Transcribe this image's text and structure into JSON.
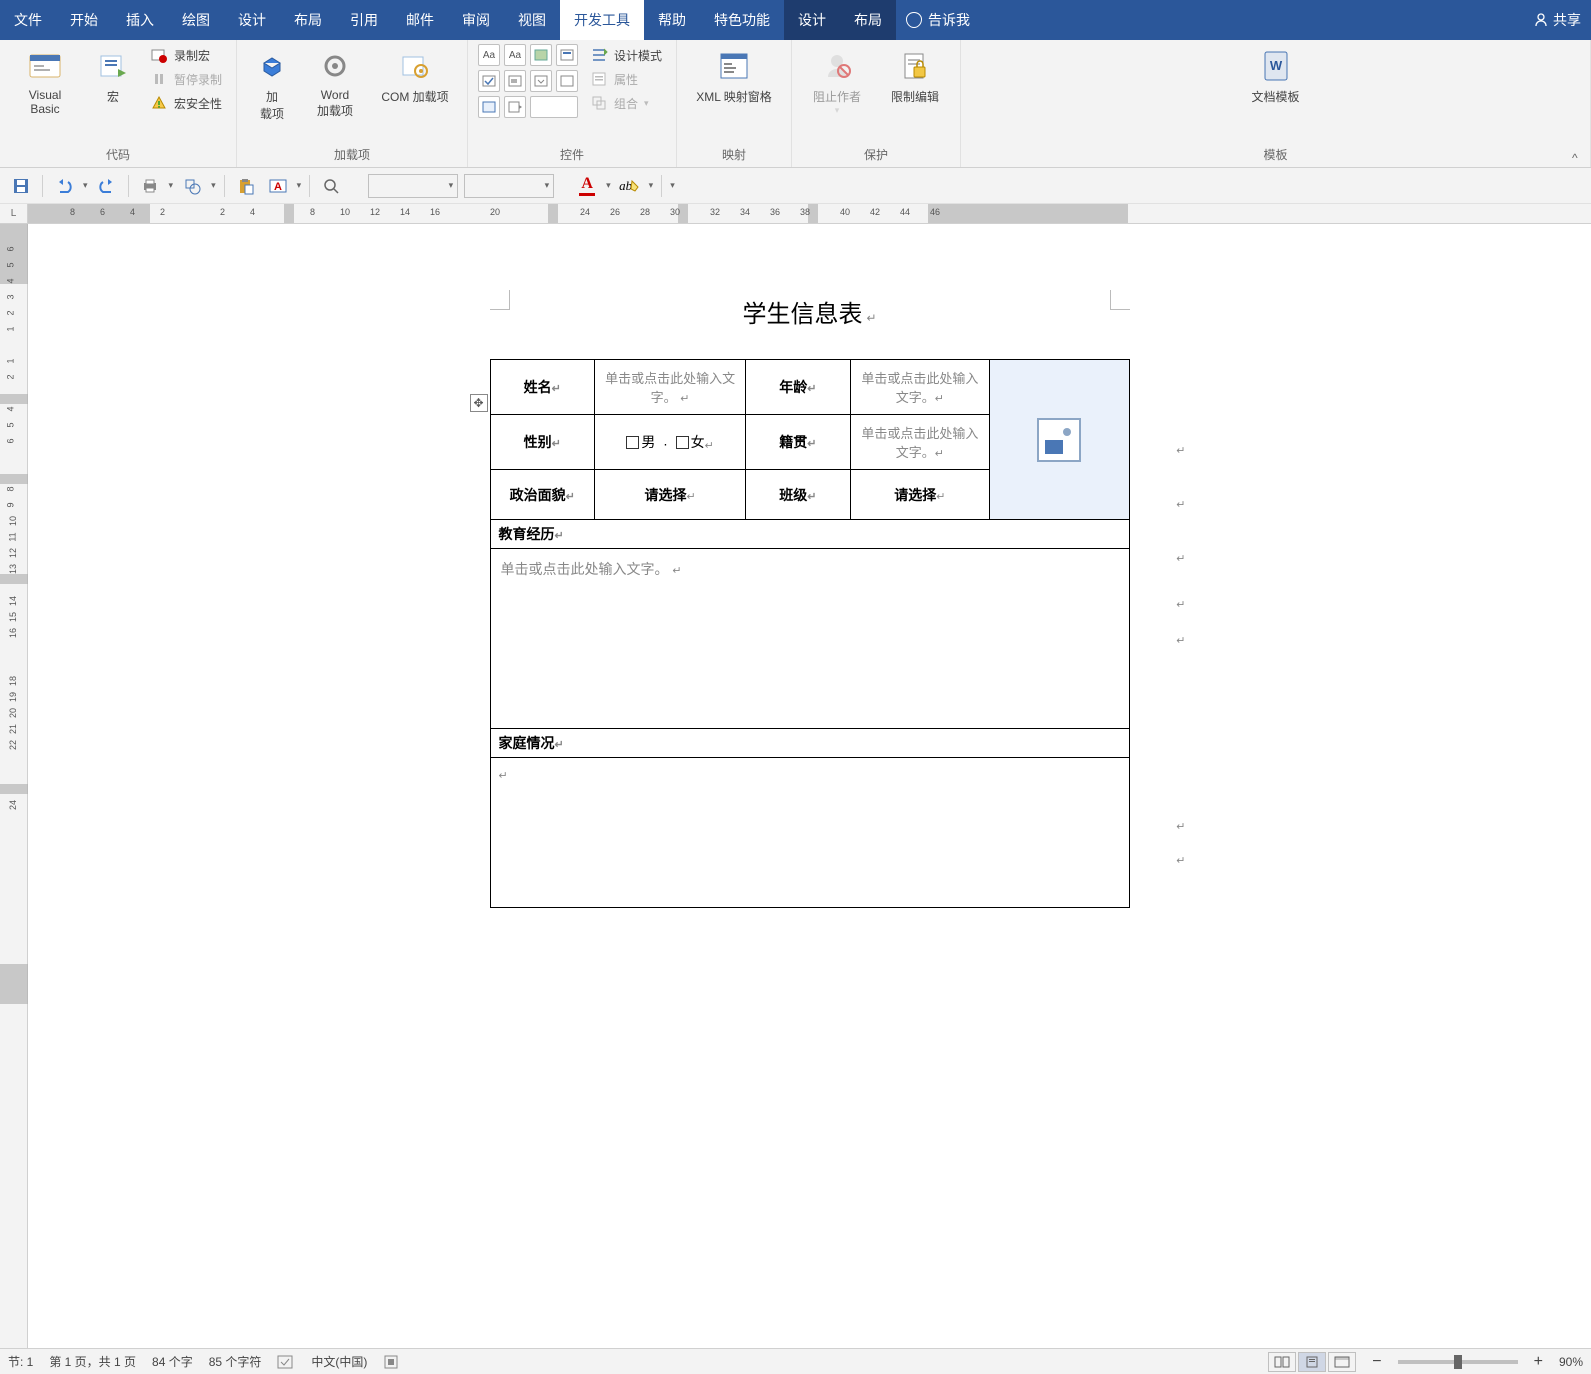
{
  "tabs": {
    "file": "文件",
    "home": "开始",
    "insert": "插入",
    "draw": "绘图",
    "design": "设计",
    "layout": "布局",
    "ref": "引用",
    "mail": "邮件",
    "review": "审阅",
    "view": "视图",
    "dev": "开发工具",
    "help": "帮助",
    "feature": "特色功能",
    "design2": "设计",
    "layout2": "布局",
    "tellme": "告诉我",
    "share": "共享"
  },
  "ribbon": {
    "code": {
      "vb": "Visual Basic",
      "macro": "宏",
      "record": "录制宏",
      "pause": "暂停录制",
      "security": "宏安全性",
      "label": "代码"
    },
    "addins": {
      "addin": "加\n载项",
      "word": "Word\n加载项",
      "com": "COM 加载项",
      "label": "加载项"
    },
    "controls": {
      "designmode": "设计模式",
      "properties": "属性",
      "group": "组合",
      "label": "控件"
    },
    "mapping": {
      "xml": "XML 映射窗格",
      "label": "映射"
    },
    "protect": {
      "block": "阻止作者",
      "restrict": "限制编辑",
      "label": "保护"
    },
    "template": {
      "doc": "文档模板",
      "label": "模板"
    }
  },
  "doc": {
    "title": "学生信息表",
    "r1": {
      "name": "姓名",
      "name_ph": "单击或点击此处输入文字。",
      "age": "年龄",
      "age_ph": "单击或点击此处输入文字。"
    },
    "r2": {
      "gender": "性别",
      "male": "男",
      "female": "女",
      "origin": "籍贯",
      "origin_ph": "单击或点击此处输入文字。"
    },
    "r3": {
      "pol": "政治面貌",
      "pol_ph": "请选择",
      "class": "班级",
      "class_ph": "请选择"
    },
    "edu": "教育经历",
    "edu_ph": "单击或点击此处输入文字。",
    "fam": "家庭情况"
  },
  "status": {
    "section": "节: 1",
    "page": "第 1 页，共 1 页",
    "words": "84 个字",
    "chars": "85 个字符",
    "lang": "中文(中国)",
    "zoom": "90%"
  }
}
